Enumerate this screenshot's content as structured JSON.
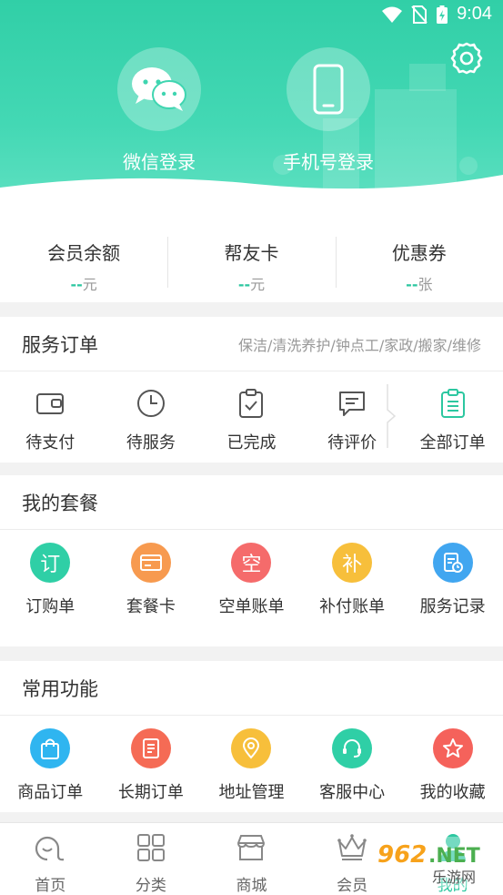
{
  "status_bar": {
    "time": "9:04"
  },
  "login": {
    "wechat_label": "微信登录",
    "phone_label": "手机号登录"
  },
  "stats": [
    {
      "title": "会员余额",
      "value": "--",
      "unit": "元"
    },
    {
      "title": "帮友卡",
      "value": "--",
      "unit": "元"
    },
    {
      "title": "优惠券",
      "value": "--",
      "unit": "张"
    }
  ],
  "service_orders": {
    "title": "服务订单",
    "subtitle": "保洁/清洗养护/钟点工/家政/搬家/维修",
    "items": [
      {
        "label": "待支付",
        "icon": "wallet-icon"
      },
      {
        "label": "待服务",
        "icon": "clock-icon"
      },
      {
        "label": "已完成",
        "icon": "clipboard-check-icon"
      },
      {
        "label": "待评价",
        "icon": "comment-icon"
      },
      {
        "label": "全部订单",
        "icon": "clipboard-list-icon"
      }
    ]
  },
  "packages": {
    "title": "我的套餐",
    "items": [
      {
        "label": "订购单",
        "glyph": "订",
        "color": "#2fcfa6"
      },
      {
        "label": "套餐卡",
        "glyph": "",
        "color": "#f79a4f"
      },
      {
        "label": "空单账单",
        "glyph": "空",
        "color": "#f56b6b"
      },
      {
        "label": "补付账单",
        "glyph": "补",
        "color": "#f7bf3b"
      },
      {
        "label": "服务记录",
        "glyph": "",
        "color": "#41a6f0"
      }
    ]
  },
  "functions": {
    "title": "常用功能",
    "items": [
      {
        "label": "商品订单",
        "color": "#2fb5f0"
      },
      {
        "label": "长期订单",
        "color": "#f56b55"
      },
      {
        "label": "地址管理",
        "color": "#f7bf3b"
      },
      {
        "label": "客服中心",
        "color": "#2fcfa6"
      },
      {
        "label": "我的收藏",
        "color": "#f5625b"
      }
    ]
  },
  "tabbar": [
    {
      "label": "首页",
      "icon": "home-icon"
    },
    {
      "label": "分类",
      "icon": "grid-icon"
    },
    {
      "label": "商城",
      "icon": "store-icon"
    },
    {
      "label": "会员",
      "icon": "crown-icon"
    },
    {
      "label": "我的",
      "icon": "profile-icon"
    }
  ],
  "watermark": {
    "text": "962.NET",
    "subtext": "乐游网"
  },
  "colors": {
    "accent": "#2cc7a0",
    "header": "#3fd5b0"
  }
}
